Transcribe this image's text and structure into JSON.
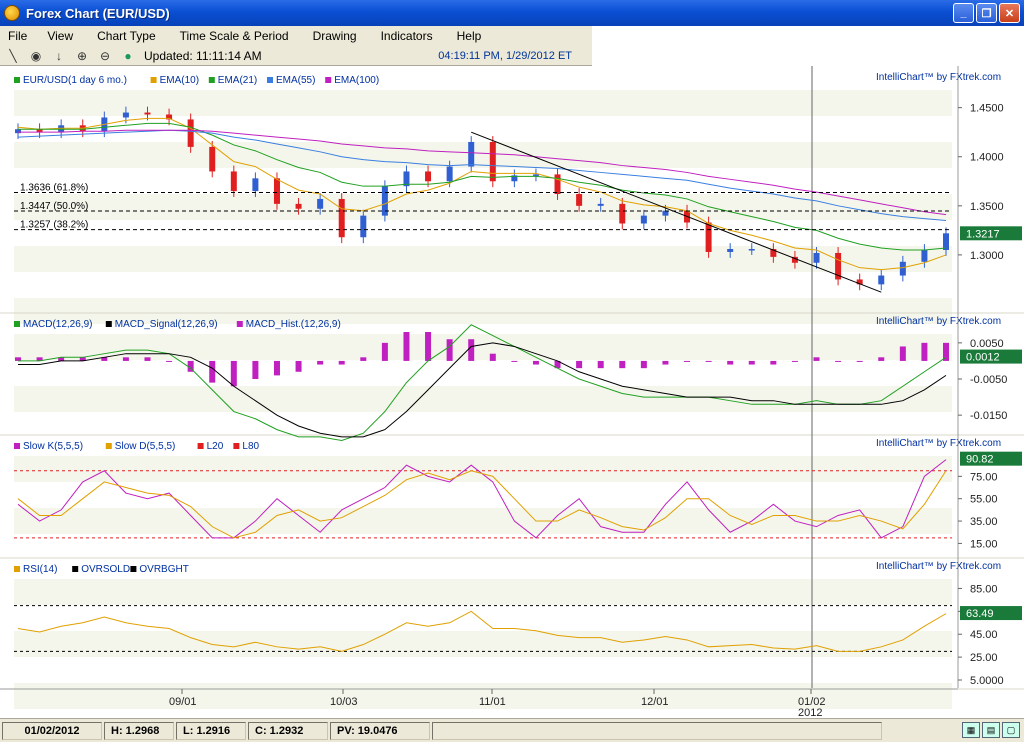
{
  "window": {
    "title": "Forex Chart (EUR/USD)"
  },
  "menu": [
    "File",
    "View",
    "Chart Type",
    "Time Scale & Period",
    "Drawing",
    "Indicators",
    "Help"
  ],
  "toolbar": {
    "updated": "Updated: 11:11:14 AM",
    "datetime": "04:19:11 PM, 1/29/2012 ET"
  },
  "brand": {
    "credit": "IntelliChart™ by FXtrek.com"
  },
  "colors": {
    "up": "#2f5fd0",
    "down": "#e02020",
    "ema10": "#e0a000",
    "ema21": "#20a020",
    "ema55": "#3a7fe0",
    "ema100": "#c020c0",
    "macd": "#20a020",
    "signal": "#000000",
    "hist": "#c020c0",
    "slowk": "#c020c0",
    "slowd": "#e0a000",
    "rsi": "#e0a000",
    "band": "#f4f6ec"
  },
  "price_panel": {
    "legend": [
      {
        "label": "EUR/USD(1 day  6 mo.)",
        "color": "#20a020"
      },
      {
        "label": "EMA(10)",
        "color": "#e0a000"
      },
      {
        "label": "EMA(21)",
        "color": "#20a020"
      },
      {
        "label": "EMA(55)",
        "color": "#3a7fe0"
      },
      {
        "label": "EMA(100)",
        "color": "#c020c0"
      }
    ],
    "axis_ticks": [
      "1.4500",
      "1.4000",
      "1.3500",
      "1.3000"
    ],
    "last_value": "1.3217",
    "fib_levels": [
      {
        "label": "1.3636 (61.8%)",
        "value": 1.3636
      },
      {
        "label": "1.3447 (50.0%)",
        "value": 1.3447
      },
      {
        "label": "1.3257 (38.2%)",
        "value": 1.3257
      }
    ]
  },
  "macd_panel": {
    "legend": [
      {
        "label": "MACD(12,26,9)",
        "color": "#20a020"
      },
      {
        "label": "MACD_Signal(12,26,9)",
        "color": "#000000"
      },
      {
        "label": "MACD_Hist.(12,26,9)",
        "color": "#c020c0"
      }
    ],
    "axis_ticks": [
      "0.0050",
      "-0.0050",
      "-0.0150"
    ],
    "last_value": "0.0012"
  },
  "stoch_panel": {
    "legend": [
      {
        "label": "Slow K(5,5,5)",
        "color": "#c020c0"
      },
      {
        "label": "Slow D(5,5,5)",
        "color": "#e0a000"
      },
      {
        "label": "L20",
        "color": "#e02020"
      },
      {
        "label": "L80",
        "color": "#e02020"
      }
    ],
    "axis_ticks": [
      "75.00",
      "55.00",
      "35.00",
      "15.00"
    ],
    "last_value": "90.82"
  },
  "rsi_panel": {
    "legend": [
      {
        "label": "RSI(14)",
        "color": "#e0a000"
      },
      {
        "label": "OVRSOLD",
        "color": "#000000"
      },
      {
        "label": "OVRBGHT",
        "color": "#000000"
      }
    ],
    "axis_ticks": [
      "85.00",
      "65.00",
      "45.00",
      "25.00",
      "5.0000"
    ],
    "last_value": "63.49"
  },
  "x_axis": {
    "ticks": [
      "09/01",
      "10/03",
      "11/01",
      "12/01",
      "01/02"
    ],
    "year": "2012"
  },
  "status": {
    "date": "01/02/2012",
    "high": "H: 1.2968",
    "low": "L: 1.2916",
    "close": "C: 1.2932",
    "pv": "PV: 19.0476"
  },
  "chart_data": {
    "type": "line",
    "title": "",
    "x": [
      "2011-08-01",
      "2011-08-04",
      "2011-08-09",
      "2011-08-12",
      "2011-08-17",
      "2011-08-22",
      "2011-08-25",
      "2011-08-30",
      "2011-09-02",
      "2011-09-07",
      "2011-09-12",
      "2011-09-15",
      "2011-09-20",
      "2011-09-23",
      "2011-09-28",
      "2011-10-03",
      "2011-10-06",
      "2011-10-11",
      "2011-10-14",
      "2011-10-19",
      "2011-10-24",
      "2011-10-27",
      "2011-11-01",
      "2011-11-04",
      "2011-11-09",
      "2011-11-14",
      "2011-11-17",
      "2011-11-22",
      "2011-11-25",
      "2011-11-30",
      "2011-12-05",
      "2011-12-08",
      "2011-12-13",
      "2011-12-16",
      "2011-12-21",
      "2011-12-26",
      "2011-12-29",
      "2012-01-03",
      "2012-01-06",
      "2012-01-11",
      "2012-01-16",
      "2012-01-19",
      "2012-01-24",
      "2012-01-27"
    ],
    "series": [
      {
        "name": "EUR/USD(1 day  6 mo.)",
        "values": [
          1.428,
          1.425,
          1.432,
          1.426,
          1.44,
          1.445,
          1.443,
          1.438,
          1.41,
          1.385,
          1.365,
          1.378,
          1.352,
          1.347,
          1.357,
          1.318,
          1.34,
          1.37,
          1.385,
          1.375,
          1.39,
          1.415,
          1.375,
          1.381,
          1.382,
          1.362,
          1.35,
          1.352,
          1.332,
          1.34,
          1.345,
          1.333,
          1.303,
          1.306,
          1.306,
          1.298,
          1.292,
          1.302,
          1.275,
          1.27,
          1.279,
          1.293,
          1.305,
          1.322
        ]
      },
      {
        "name": "EMA(10)",
        "values": [
          1.43,
          1.428,
          1.429,
          1.429,
          1.433,
          1.437,
          1.439,
          1.439,
          1.429,
          1.412,
          1.395,
          1.39,
          1.377,
          1.366,
          1.362,
          1.347,
          1.345,
          1.352,
          1.362,
          1.366,
          1.373,
          1.385,
          1.383,
          1.383,
          1.383,
          1.377,
          1.369,
          1.364,
          1.355,
          1.351,
          1.349,
          1.345,
          1.332,
          1.325,
          1.32,
          1.314,
          1.307,
          1.305,
          1.295,
          1.287,
          1.285,
          1.287,
          1.292,
          1.3
        ]
      },
      {
        "name": "EMA(21)",
        "values": [
          1.428,
          1.428,
          1.428,
          1.428,
          1.43,
          1.432,
          1.434,
          1.434,
          1.43,
          1.422,
          1.412,
          1.406,
          1.397,
          1.389,
          1.384,
          1.374,
          1.37,
          1.37,
          1.372,
          1.372,
          1.374,
          1.38,
          1.379,
          1.38,
          1.38,
          1.378,
          1.374,
          1.371,
          1.366,
          1.363,
          1.361,
          1.357,
          1.349,
          1.344,
          1.339,
          1.334,
          1.328,
          1.325,
          1.317,
          1.311,
          1.307,
          1.305,
          1.305,
          1.307
        ]
      },
      {
        "name": "EMA(55)",
        "values": [
          1.42,
          1.421,
          1.422,
          1.423,
          1.424,
          1.425,
          1.426,
          1.427,
          1.426,
          1.424,
          1.42,
          1.417,
          1.413,
          1.409,
          1.405,
          1.4,
          1.397,
          1.395,
          1.394,
          1.392,
          1.391,
          1.392,
          1.391,
          1.39,
          1.389,
          1.388,
          1.386,
          1.384,
          1.382,
          1.38,
          1.378,
          1.376,
          1.372,
          1.368,
          1.365,
          1.362,
          1.358,
          1.355,
          1.35,
          1.346,
          1.342,
          1.339,
          1.337,
          1.335
        ]
      },
      {
        "name": "EMA(100)",
        "values": [
          1.425,
          1.425,
          1.425,
          1.426,
          1.426,
          1.427,
          1.427,
          1.427,
          1.427,
          1.426,
          1.424,
          1.422,
          1.42,
          1.418,
          1.416,
          1.413,
          1.411,
          1.409,
          1.408,
          1.406,
          1.405,
          1.404,
          1.403,
          1.402,
          1.4,
          1.398,
          1.396,
          1.394,
          1.391,
          1.389,
          1.387,
          1.384,
          1.38,
          1.377,
          1.374,
          1.371,
          1.367,
          1.364,
          1.36,
          1.356,
          1.352,
          1.348,
          1.344,
          1.341
        ]
      }
    ],
    "ylim": [
      1.25,
      1.47
    ],
    "macd": {
      "series": [
        {
          "name": "MACD(12,26,9)",
          "values": [
            0.0,
            0.0,
            0.001,
            0.001,
            0.002,
            0.003,
            0.003,
            0.002,
            -0.002,
            -0.008,
            -0.014,
            -0.016,
            -0.019,
            -0.021,
            -0.021,
            -0.022,
            -0.02,
            -0.014,
            -0.006,
            0.0,
            0.004,
            0.01,
            0.007,
            0.004,
            0.001,
            -0.002,
            -0.005,
            -0.007,
            -0.009,
            -0.01,
            -0.01,
            -0.01,
            -0.01,
            -0.011,
            -0.012,
            -0.012,
            -0.012,
            -0.011,
            -0.012,
            -0.012,
            -0.011,
            -0.007,
            -0.003,
            0.001
          ]
        },
        {
          "name": "MACD_Signal(12,26,9)",
          "values": [
            -0.001,
            -0.001,
            0.0,
            0.0,
            0.001,
            0.002,
            0.002,
            0.002,
            0.001,
            -0.002,
            -0.007,
            -0.011,
            -0.015,
            -0.018,
            -0.02,
            -0.021,
            -0.021,
            -0.019,
            -0.014,
            -0.008,
            -0.002,
            0.004,
            0.005,
            0.004,
            0.002,
            0.0,
            -0.003,
            -0.005,
            -0.007,
            -0.008,
            -0.009,
            -0.01,
            -0.01,
            -0.01,
            -0.011,
            -0.011,
            -0.012,
            -0.012,
            -0.012,
            -0.012,
            -0.012,
            -0.011,
            -0.008,
            -0.004
          ]
        },
        {
          "name": "MACD_Hist.(12,26,9)",
          "values": [
            0.001,
            0.001,
            0.001,
            0.001,
            0.001,
            0.001,
            0.001,
            0.0,
            -0.003,
            -0.006,
            -0.007,
            -0.005,
            -0.004,
            -0.003,
            -0.001,
            -0.001,
            0.001,
            0.005,
            0.008,
            0.008,
            0.006,
            0.006,
            0.002,
            0.0,
            -0.001,
            -0.002,
            -0.002,
            -0.002,
            -0.002,
            -0.002,
            -0.001,
            0.0,
            0.0,
            -0.001,
            -0.001,
            -0.001,
            0.0,
            0.001,
            0.0,
            0.0,
            0.001,
            0.004,
            0.005,
            0.005
          ]
        }
      ],
      "ylim": [
        -0.018,
        0.008
      ]
    },
    "stochastic": {
      "series": [
        {
          "name": "Slow K(5,5,5)",
          "values": [
            50,
            35,
            45,
            70,
            80,
            60,
            55,
            60,
            40,
            20,
            20,
            35,
            55,
            40,
            25,
            45,
            55,
            65,
            85,
            75,
            70,
            85,
            70,
            35,
            20,
            40,
            55,
            30,
            25,
            25,
            50,
            70,
            45,
            25,
            35,
            50,
            35,
            30,
            40,
            45,
            20,
            30,
            75,
            90
          ]
        },
        {
          "name": "Slow D(5,5,5)",
          "values": [
            55,
            40,
            40,
            55,
            70,
            65,
            60,
            58,
            48,
            30,
            20,
            25,
            40,
            45,
            35,
            38,
            48,
            58,
            72,
            78,
            72,
            80,
            75,
            55,
            35,
            35,
            45,
            38,
            30,
            27,
            38,
            55,
            55,
            40,
            32,
            40,
            40,
            35,
            35,
            40,
            35,
            28,
            50,
            80
          ]
        }
      ],
      "ylim": [
        10,
        95
      ],
      "levels": [
        20,
        80
      ]
    },
    "rsi": {
      "series": [
        {
          "name": "RSI(14)",
          "values": [
            50,
            47,
            52,
            55,
            60,
            55,
            52,
            50,
            42,
            36,
            34,
            38,
            34,
            32,
            34,
            30,
            36,
            45,
            55,
            52,
            55,
            65,
            50,
            50,
            48,
            44,
            42,
            42,
            38,
            40,
            43,
            40,
            34,
            35,
            36,
            33,
            32,
            35,
            30,
            30,
            34,
            40,
            52,
            63
          ]
        }
      ],
      "ylim": [
        5,
        95
      ],
      "levels": [
        30,
        70
      ]
    }
  }
}
